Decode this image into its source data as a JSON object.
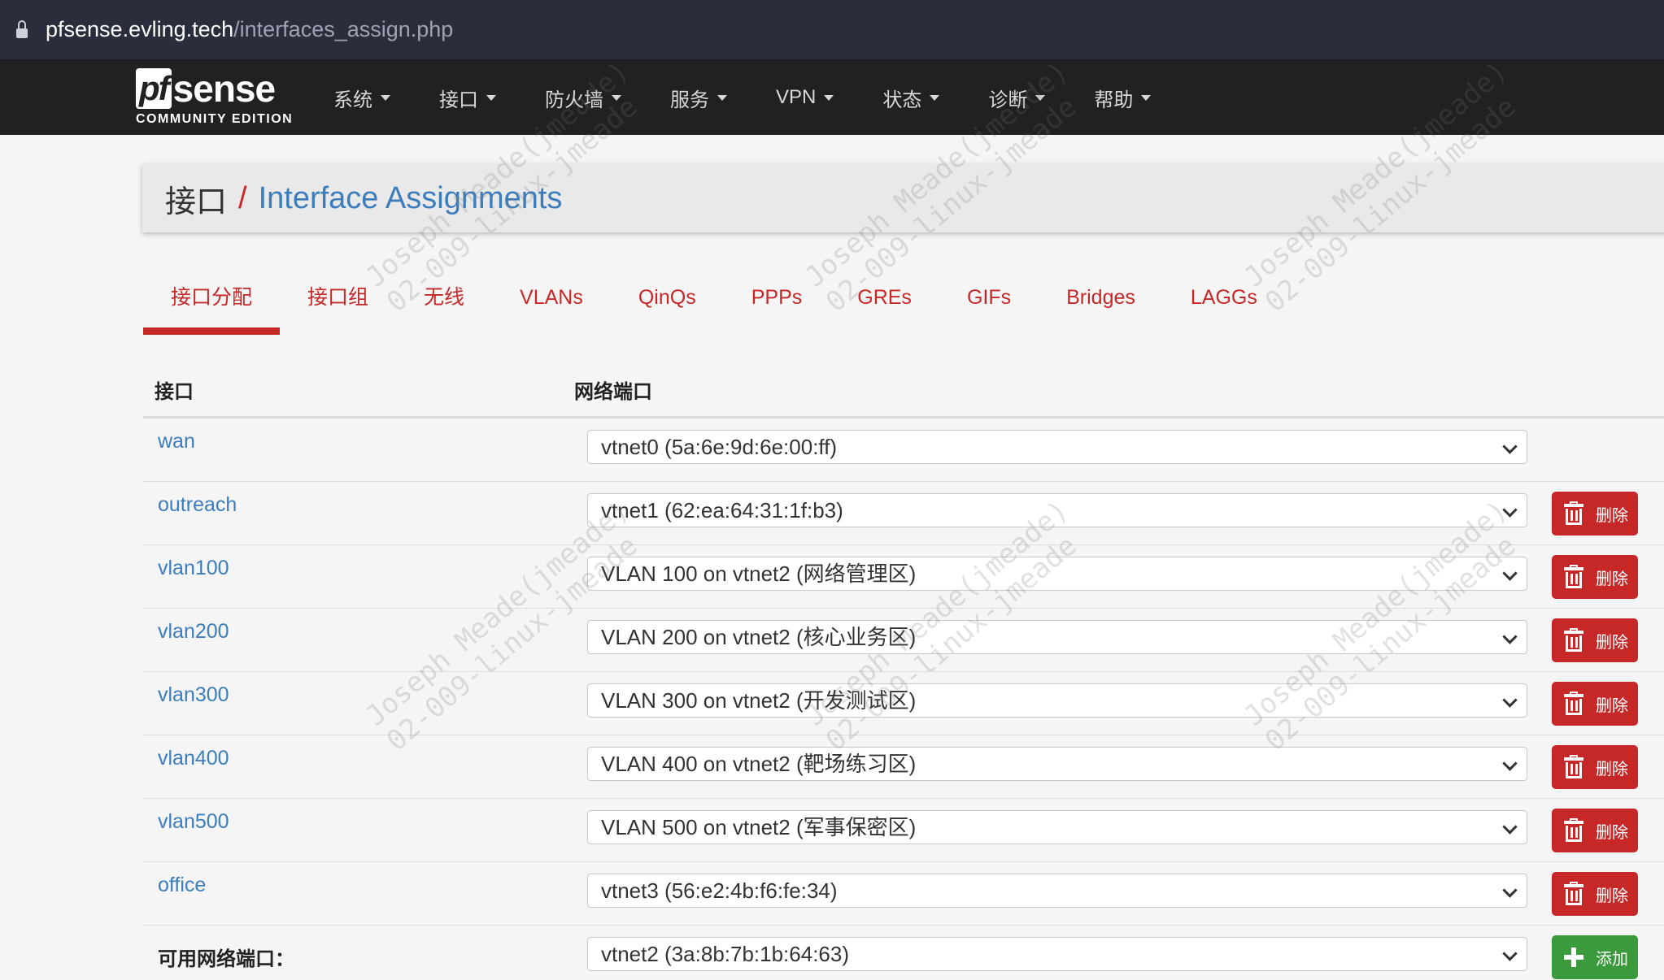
{
  "browser": {
    "url_host": "pfsense.evling.tech",
    "url_path": "/interfaces_assign.php"
  },
  "navbar": {
    "brand_pf": "pf",
    "brand_sense": "sense",
    "brand_edition": "COMMUNITY EDITION",
    "menu": [
      "系统",
      "接口",
      "防火墙",
      "服务",
      "VPN",
      "状态",
      "诊断",
      "帮助"
    ]
  },
  "breadcrumb": {
    "parent": "接口",
    "separator": "/",
    "current": "Interface Assignments"
  },
  "tabs": [
    "接口分配",
    "接口组",
    "无线",
    "VLANs",
    "QinQs",
    "PPPs",
    "GREs",
    "GIFs",
    "Bridges",
    "LAGGs"
  ],
  "table": {
    "headers": {
      "interface": "接口",
      "port": "网络端口"
    },
    "rows": [
      {
        "name": "wan",
        "port": "vtnet0 (5a:6e:9d:6e:00:ff)",
        "action": ""
      },
      {
        "name": "outreach",
        "port": "vtnet1 (62:ea:64:31:1f:b3)",
        "action": "删除"
      },
      {
        "name": "vlan100",
        "port": "VLAN 100 on vtnet2 (网络管理区)",
        "action": "删除"
      },
      {
        "name": "vlan200",
        "port": "VLAN 200 on vtnet2 (核心业务区)",
        "action": "删除"
      },
      {
        "name": "vlan300",
        "port": "VLAN 300 on vtnet2 (开发测试区)",
        "action": "删除"
      },
      {
        "name": "vlan400",
        "port": "VLAN 400 on vtnet2 (靶场练习区)",
        "action": "删除"
      },
      {
        "name": "vlan500",
        "port": "VLAN 500 on vtnet2 (军事保密区)",
        "action": "删除"
      },
      {
        "name": "office",
        "port": "vtnet3 (56:e2:4b:f6:fe:34)",
        "action": "删除"
      }
    ],
    "available": {
      "label": "可用网络端口：",
      "port": "vtnet2 (3a:8b:7b:1b:64:63)",
      "action": "添加"
    }
  },
  "watermark": {
    "line1": "Joseph Meade(jmeade)",
    "line2": "02-009-linux-jmeade"
  },
  "colors": {
    "accent_red": "#c62828",
    "link_blue": "#3b7dbd",
    "navbar": "#212121",
    "add_green": "#3b9a3b"
  }
}
